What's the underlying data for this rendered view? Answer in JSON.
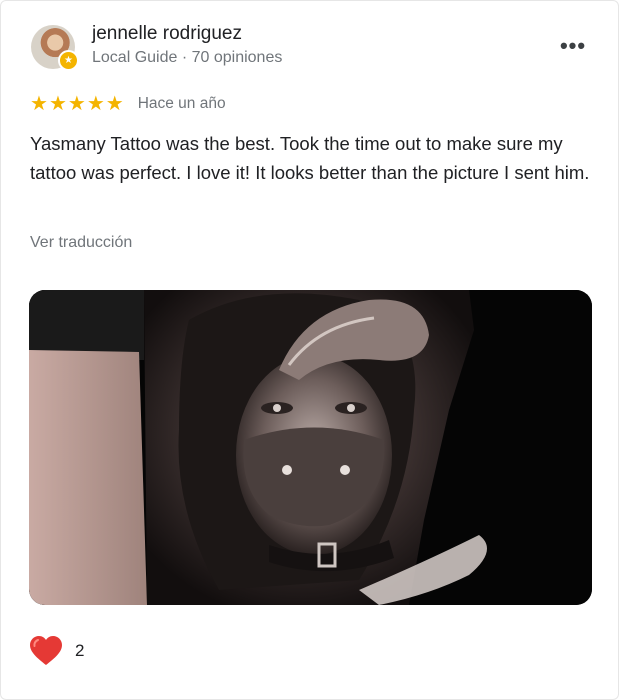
{
  "review": {
    "author_name": "jennelle rodriguez",
    "author_meta": "Local Guide · 70 opiniones",
    "rating": 5,
    "date": "Hace un año",
    "text": "Yasmany Tattoo was the best. Took the time out to make sure my tattoo was perfect. I love it! It looks better than the picture I sent him.",
    "translate_label": "Ver traducción",
    "reaction_count": "2"
  },
  "icons": {
    "more": "more-options-icon",
    "star": "star-icon",
    "heart": "heart-icon",
    "badge": "local-guide-badge-icon"
  },
  "colors": {
    "star": "#f4b400",
    "heart": "#e53935",
    "muted_text": "#70757a",
    "body_text": "#202124"
  }
}
